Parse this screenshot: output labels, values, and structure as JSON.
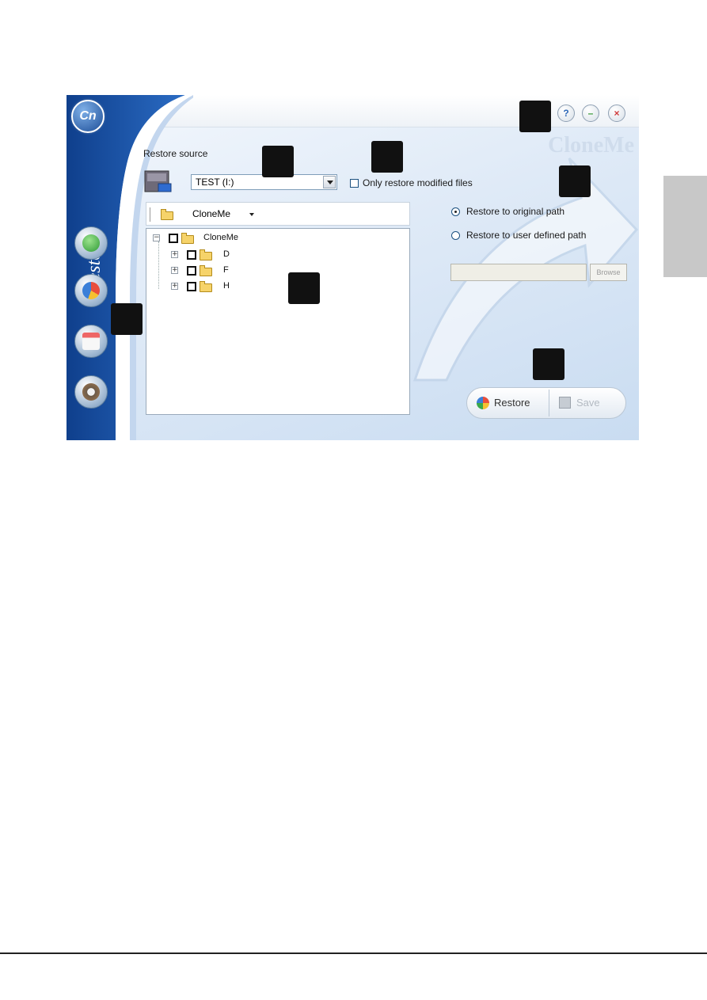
{
  "window": {
    "brand": "CloneMe",
    "logo_text": "Cn",
    "mode_label": "Restore",
    "title_buttons": {
      "help": "?",
      "minimize": "–",
      "close": "×"
    }
  },
  "sidebar": {
    "items": [
      {
        "icon": "backup-icon"
      },
      {
        "icon": "restore-icon"
      },
      {
        "icon": "schedule-icon"
      },
      {
        "icon": "settings-icon"
      }
    ]
  },
  "restore_source": {
    "label": "Restore source",
    "selected_drive": "TEST (I:)",
    "only_modified_label": "Only restore modified files",
    "only_modified_checked": false
  },
  "folder_bar": {
    "current": "CloneMe"
  },
  "tree": {
    "root": "CloneMe",
    "children": [
      "D",
      "F",
      "H"
    ]
  },
  "destination": {
    "original_label": "Restore to original path",
    "user_label": "Restore to user defined path",
    "selected": "original",
    "path_value": "",
    "browse_label": "Browse"
  },
  "actions": {
    "restore_label": "Restore",
    "save_label": "Save"
  },
  "colors": {
    "sidebar_blue": "#1f56a6",
    "callout": "#111111",
    "page_tab": "#c8c8c8"
  }
}
